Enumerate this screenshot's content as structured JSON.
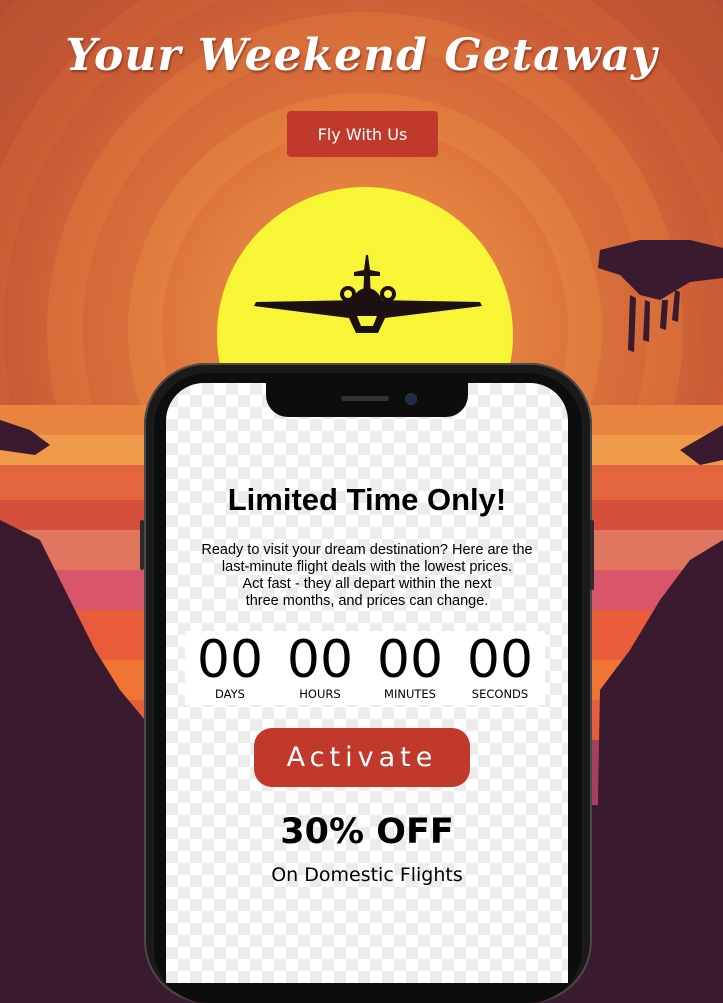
{
  "header": {
    "title": "Your Weekend Getaway",
    "cta_label": "Fly With Us"
  },
  "promo": {
    "heading": "Limited Time Only!",
    "description_lines": [
      "Ready to visit your dream destination? Here are the",
      "last-minute flight deals with the lowest prices.",
      "Act fast - they all depart within the next",
      "three months, and prices can change."
    ],
    "countdown": [
      {
        "value": "00",
        "label": "DAYS"
      },
      {
        "value": "00",
        "label": "HOURS"
      },
      {
        "value": "00",
        "label": "MINUTES"
      },
      {
        "value": "00",
        "label": "SECONDS"
      }
    ],
    "activate_label": "Activate",
    "discount": "30% OFF",
    "discount_subtitle": "On Domestic Flights"
  },
  "colors": {
    "accent_button": "#c0392b",
    "sun": "#f7f535",
    "sky_orange": "#e07a3e",
    "silhouette": "#3a1a2e"
  },
  "icons": {
    "airplane": "airplane-icon",
    "sun": "sun-graphic"
  }
}
